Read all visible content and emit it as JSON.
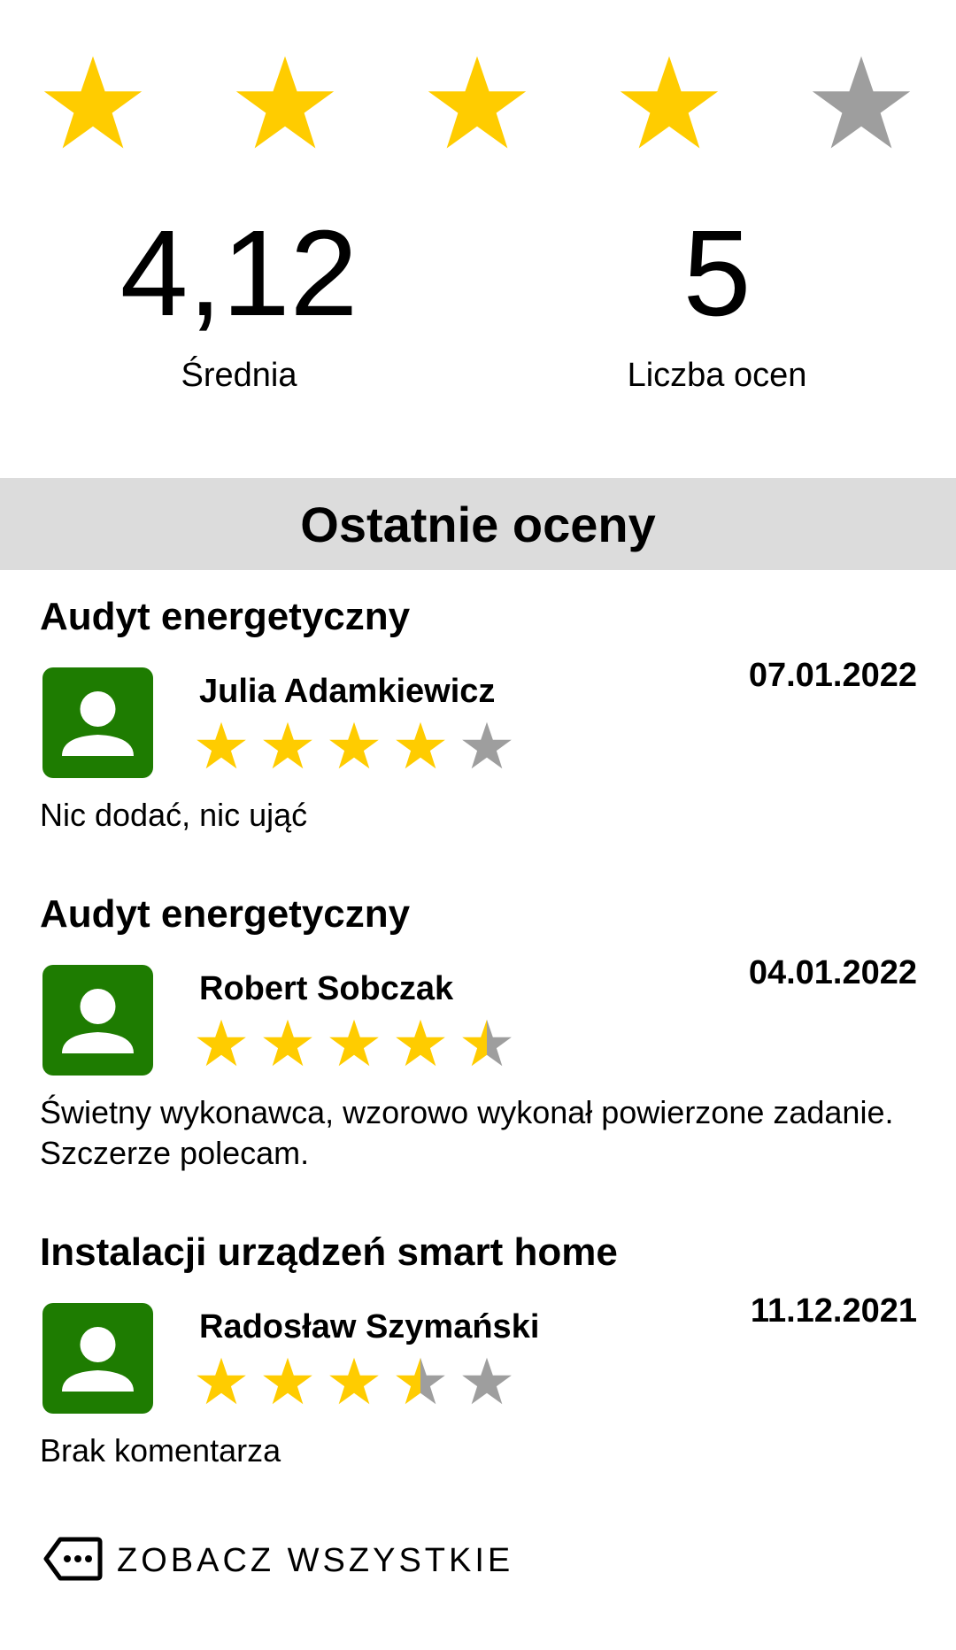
{
  "summary": {
    "stars": [
      1,
      1,
      1,
      1,
      0
    ],
    "average_value": "4,12",
    "average_label": "Średnia",
    "count_value": "5",
    "count_label": "Liczba ocen"
  },
  "section_title": "Ostatnie oceny",
  "reviews": [
    {
      "service": "Audyt energetyczny",
      "name": "Julia Adamkiewicz",
      "date": "07.01.2022",
      "stars": [
        1,
        1,
        1,
        1,
        0
      ],
      "comment": "Nic dodać, nic ująć"
    },
    {
      "service": "Audyt energetyczny",
      "name": "Robert Sobczak",
      "date": "04.01.2022",
      "stars": [
        1,
        1,
        1,
        1,
        0.5
      ],
      "comment": "Świetny wykonawca, wzorowo wykonał powierzone zadanie. Szczerze polecam."
    },
    {
      "service": "Instalacji urządzeń smart home",
      "name": "Radosław Szymański",
      "date": "11.12.2021",
      "stars": [
        1,
        1,
        1,
        0.5,
        0
      ],
      "comment": "Brak komentarza"
    }
  ],
  "see_all_label": "ZOBACZ WSZYSTKIE",
  "colors": {
    "star_filled": "#ffcc00",
    "star_empty": "#9e9e9e",
    "avatar_bg": "#1e7c01",
    "section_bg": "#dcdcdc"
  },
  "icons": {
    "star": "star-icon",
    "avatar": "person-icon",
    "see_all": "more-tag-icon"
  }
}
